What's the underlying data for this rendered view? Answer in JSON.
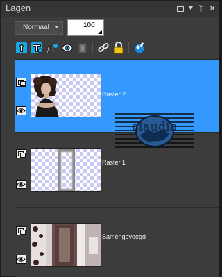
{
  "panel": {
    "title": "Lagen",
    "title_buttons": [
      {
        "name": "maximize-icon"
      },
      {
        "name": "menu-arrow-icon",
        "glyph": "▼"
      },
      {
        "name": "pin-icon",
        "glyph": "ᛘ"
      },
      {
        "name": "close-icon",
        "glyph": "✕"
      }
    ]
  },
  "blend": {
    "mode": "Normaal",
    "opacity": "100"
  },
  "toolbar": {
    "icons": [
      "new-raster-layer-icon",
      "new-vector-layer-icon",
      "new-adjustment-layer-icon",
      "new-mask-icon",
      "delete-layer-icon",
      "link-icon",
      "lock-icon",
      "properties-icon"
    ]
  },
  "layers": [
    {
      "name": "Raster 2",
      "selected": true,
      "visible": true
    },
    {
      "name": "Raster 1",
      "selected": false,
      "visible": true
    },
    {
      "name": "Samengevoegd",
      "selected": false,
      "visible": true
    }
  ],
  "watermark": {
    "text": "claudia"
  },
  "colors": {
    "selected_row": "#3399ff",
    "panel_bg": "#3c3c3c",
    "titlebar_bg": "#353535",
    "text": "#f0f0f0"
  }
}
